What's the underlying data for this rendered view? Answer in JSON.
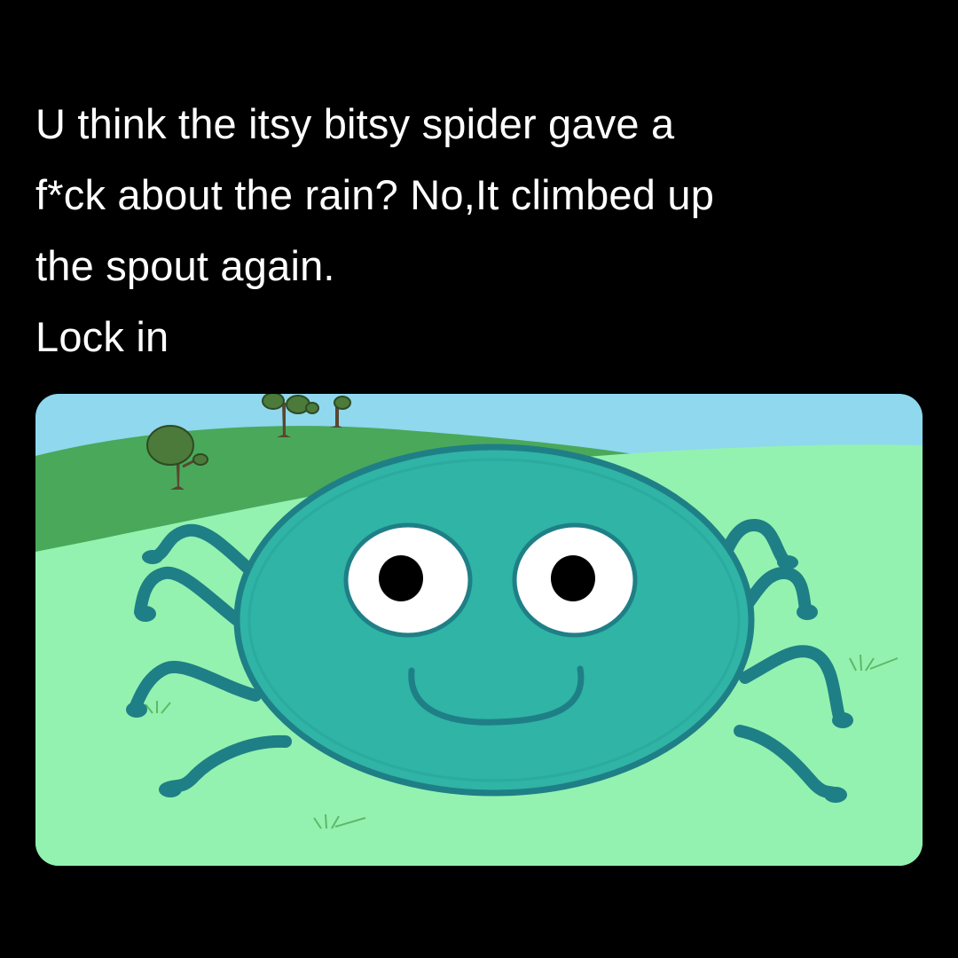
{
  "caption": {
    "lines": [
      "U think the itsy bitsy spider gave a",
      "f*ck about the rain? No,It climbed up",
      "the spout again.",
      "Lock in"
    ]
  },
  "illustration": {
    "subject": "cartoon-spider",
    "colors": {
      "sky": "#8fd8ee",
      "hill": "#4aa85a",
      "grass": "#93f2b0",
      "body": "#2fb4a6",
      "outline": "#1f7f86",
      "eye_white": "#ffffff",
      "pupil": "#000000",
      "tree_leaf": "#4b7a3a",
      "trunk": "#5a4630"
    }
  }
}
